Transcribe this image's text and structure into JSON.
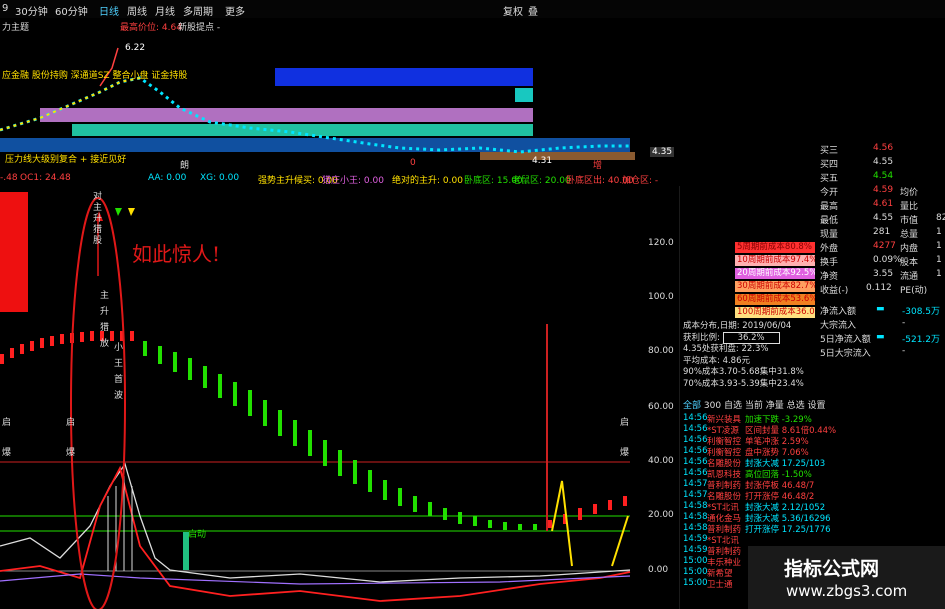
{
  "toolbar": {
    "items": [
      "9",
      "30分钟",
      "60分钟",
      "日线",
      "周线",
      "月线",
      "多周期",
      "更多"
    ],
    "right": [
      "复权",
      "叠"
    ],
    "sub_title": "力主题",
    "indicator_text": "最高价位: 4.64",
    "note": "新股提点 -"
  },
  "kchart": {
    "high_label": "6.22",
    "low_label": "4.31",
    "price_right": "4.35",
    "caption": "压力线大级别复合 + 接近见好",
    "marks": [
      "朗",
      "0",
      "增"
    ],
    "tag_row": "应金融 股份持购 深通道SZ 整合小盘 证金持股"
  },
  "indicator_bar": {
    "items": [
      "-.48",
      "OC1: 24.48",
      "AA: 0.00",
      "XG: 0.00",
      "强势主升候买: 0.00",
      "猎庄小王: 0.00",
      "绝对的主升: 0.00",
      "卧底区: 15.00",
      "老鼠区: 20.00",
      "卧底区出: 40.00",
      "加仓区: -"
    ]
  },
  "main": {
    "annotation": "如此惊人!",
    "vertical_text": "对主升猎股",
    "v_labels": [
      "主",
      "升",
      "猎",
      "放",
      "小",
      "王",
      "首",
      "波"
    ],
    "side_labels": [
      "启",
      "爆"
    ],
    "y_ticks": [
      "120.0",
      "100.0",
      "80.00",
      "60.00",
      "40.00",
      "20.00",
      "0.00"
    ],
    "small_mark": "启动"
  },
  "quotes": {
    "rows": [
      {
        "label": "买三",
        "value": "4.56",
        "extra": ""
      },
      {
        "label": "买四",
        "value": "4.55",
        "extra": ""
      },
      {
        "label": "买五",
        "value": "4.54",
        "extra": ""
      },
      {
        "label": "今开",
        "value": "4.59",
        "extra": "均价"
      },
      {
        "label": "最高",
        "value": "4.61",
        "extra": "量比"
      },
      {
        "label": "最低",
        "value": "4.55",
        "extra": "市值"
      },
      {
        "label": "现量",
        "value": "281",
        "extra": "总量"
      },
      {
        "label": "外盘",
        "value": "4277",
        "extra": "内盘"
      },
      {
        "label": "换手",
        "value": "0.09%",
        "extra": "股本"
      },
      {
        "label": "净资",
        "value": "3.55",
        "extra": "流通"
      },
      {
        "label": "收益(-)",
        "value": "0.112",
        "extra": "PE(动)"
      }
    ],
    "right_digits": [
      "82",
      "1",
      "1",
      "1",
      "1"
    ]
  },
  "cost": {
    "boxes": [
      "5周期前成本80.8%",
      "10周期前成本97.4%",
      "20周期前成本92.5%",
      "30周期前成本82.7%",
      "60周期前成本53.6%",
      "100周期前成本36.0%"
    ],
    "date_label": "成本分布,日期:",
    "date": "2019/06/04",
    "profit_label": "获利比例:",
    "profit": "36.2%",
    "lines": [
      "4.35处获利盘: 22.3%",
      "平均成本: 4.86元",
      "90%成本3.70-5.68集中31.8%",
      "70%成本3.93-5.39集中23.4%"
    ]
  },
  "flows": [
    {
      "label": "净流入额",
      "value": "-308.5万"
    },
    {
      "label": "大宗流入",
      "value": "-"
    },
    {
      "label": "5日净流入额",
      "value": "-521.2万"
    },
    {
      "label": "5日大宗流入",
      "value": "-"
    }
  ],
  "tape": {
    "tabs": [
      "全部",
      "300",
      "自选",
      "当前",
      "净量",
      "总选",
      "设置"
    ],
    "rows": [
      {
        "t": "14:56",
        "n": "新兴装具",
        "s": "加速下跌 -3.29%"
      },
      {
        "t": "14:56",
        "n": "*ST凌源",
        "s": "区间封量 8.61倍0.44%"
      },
      {
        "t": "14:56",
        "n": "利衡智控",
        "s": "单笔冲涨 2.59%"
      },
      {
        "t": "14:56",
        "n": "利衡智控",
        "s": "盘中涨势 7.06%"
      },
      {
        "t": "14:56",
        "n": "名雕股份",
        "s": "封涨大减 17.25/103"
      },
      {
        "t": "14:56",
        "n": "凯恩科技",
        "s": "高位回落 -1.50%"
      },
      {
        "t": "14:57",
        "n": "普利制药",
        "s": "封涨停板 46.48/7"
      },
      {
        "t": "14:57",
        "n": "名雕股份",
        "s": "打开涨停 46.48/2"
      },
      {
        "t": "14:58",
        "n": "*ST北讯",
        "s": "封涨大减 2.12/1052"
      },
      {
        "t": "14:58",
        "n": "通化金马",
        "s": "封涨大减 5.36/16296"
      },
      {
        "t": "14:58",
        "n": "普利制药",
        "s": "打开涨停 17.25/1776"
      },
      {
        "t": "14:59",
        "n": "*ST北讯",
        "s": ""
      },
      {
        "t": "14:59",
        "n": "普利制药",
        "s": ""
      },
      {
        "t": "15:00",
        "n": "丰乐种业",
        "s": ""
      },
      {
        "t": "15:00",
        "n": "新希望",
        "s": ""
      },
      {
        "t": "15:00",
        "n": "卫士通",
        "s": ""
      }
    ]
  },
  "watermark": {
    "title": "指标公式网",
    "url": "www.zbgs3.com"
  },
  "colors": {
    "cyan": "#00e5ff",
    "green": "#22e000",
    "red": "#ff2020",
    "yellow": "#ffe000",
    "magenta": "#e060e0",
    "orange": "#ff9900"
  }
}
